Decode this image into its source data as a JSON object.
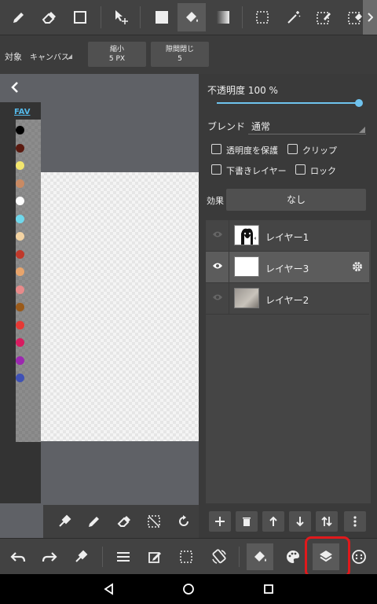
{
  "options": {
    "target_label": "対象",
    "target_value": "キャンバス",
    "shrink_title": "縮小",
    "shrink_value": "5 PX",
    "gap_title": "隙間閉じ",
    "gap_value": "5"
  },
  "palette": {
    "fav_label": "FAV",
    "colors": [
      "#000000",
      "#5a1a10",
      "#f3e66e",
      "#c98a63",
      "#ffffff",
      "#6fd8ec",
      "#f3d3a3",
      "#c0392b",
      "#e8a46b",
      "#e88a8a",
      "#9a5a1a",
      "#e53935",
      "#d81b60",
      "#9c27b0",
      "#3f51b5"
    ]
  },
  "panel": {
    "opacity_label": "不透明度 100 %",
    "opacity_value": 100,
    "blend_label": "ブレンド",
    "blend_value": "通常",
    "protect_alpha": "透明度を保護",
    "clip": "クリップ",
    "draft_layer": "下書きレイヤー",
    "lock": "ロック",
    "effect_label": "効果",
    "effect_value": "なし",
    "layers": [
      {
        "name": "レイヤー1",
        "visible": false,
        "selected": false
      },
      {
        "name": "レイヤー3",
        "visible": true,
        "selected": true
      },
      {
        "name": "レイヤー2",
        "visible": false,
        "selected": false
      }
    ]
  },
  "colors": {
    "accent": "#6fc3ee",
    "highlight": "#e0191c",
    "toolbar_bg": "#424242"
  }
}
